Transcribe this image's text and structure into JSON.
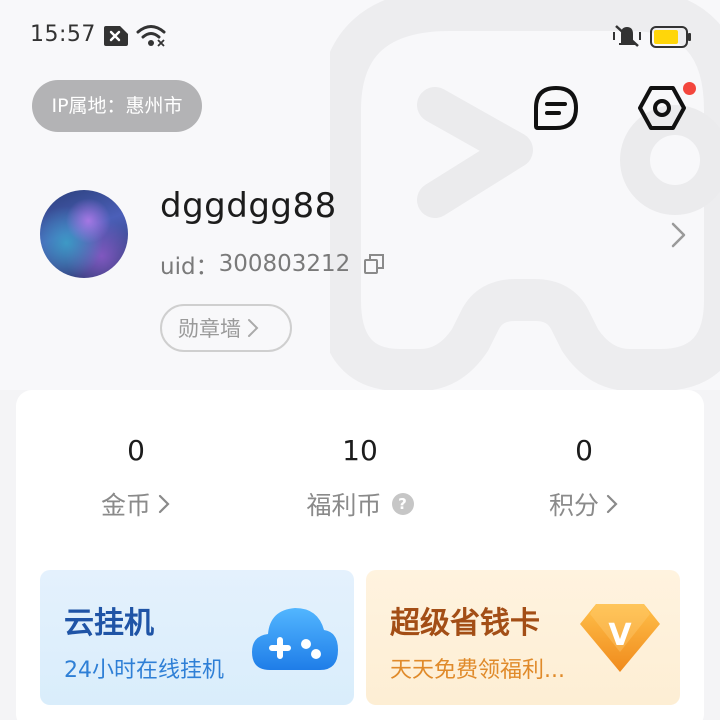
{
  "status_bar": {
    "time": "15:57",
    "icons": [
      "sim-off-icon",
      "wifi-icon",
      "mute-vibrate-icon",
      "battery-icon"
    ],
    "battery_color": "#ffd60a"
  },
  "header": {
    "ip_location": "IP属地：惠州市",
    "message_icon": "message-icon",
    "settings_icon": "settings-hex-icon",
    "notification_color": "#f3463d"
  },
  "profile": {
    "username": "dggdgg88",
    "uid_label": "uid：",
    "uid_value": "300803212",
    "badge_wall_label": "勋章墙"
  },
  "stats": [
    {
      "value": "0",
      "label": "金币",
      "trailing": "chevron-right-icon"
    },
    {
      "value": "10",
      "label": "福利币",
      "trailing": "help-icon",
      "help_glyph": "?"
    },
    {
      "value": "0",
      "label": "积分",
      "trailing": "chevron-right-icon"
    }
  ],
  "promos": [
    {
      "title": "云挂机",
      "subtitle": "24小时在线挂机",
      "icon": "cloud-gamepad-icon",
      "accent": "#1f54a6"
    },
    {
      "title": "超级省钱卡",
      "subtitle": "天天免费领福利...",
      "icon": "vip-diamond-icon",
      "accent": "#a34e16",
      "icon_letter": "V"
    }
  ]
}
